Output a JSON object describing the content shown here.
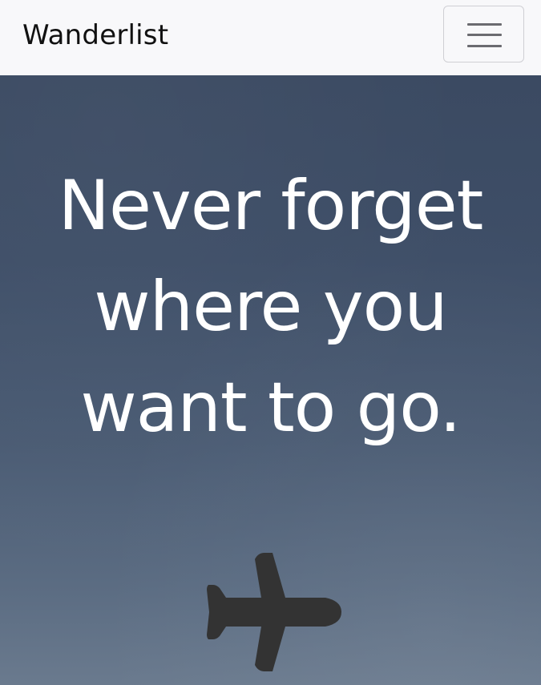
{
  "navbar": {
    "brand": "Wanderlist",
    "menu_toggle_icon": "hamburger-icon"
  },
  "hero": {
    "headline_line1": "Never forget",
    "headline_line2": "where you",
    "headline_line3": "want to go.",
    "icon": "airplane-icon",
    "icon_color": "#333333",
    "background_color": "#3e4e67"
  }
}
